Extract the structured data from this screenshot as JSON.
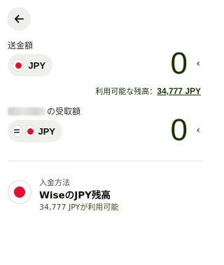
{
  "header": {
    "back_icon": "arrow-left-icon"
  },
  "send": {
    "label": "送金額",
    "currency": "JPY",
    "flag_icon": "japan-flag-icon",
    "amount": "0",
    "chevron": "‹",
    "balance_prefix": "利用可能な残高：",
    "balance_value": "34,777 JPY"
  },
  "receive": {
    "label_suffix": "の受取額",
    "currency": "JPY",
    "equals_icon": "equals-icon",
    "flag_icon": "japan-flag-icon",
    "amount": "0",
    "chevron": "‹"
  },
  "payment_method": {
    "label": "入金方法",
    "name": "WiseのJPY残高",
    "subtext": "34,777 JPYが利用可能",
    "flag_icon": "japan-flag-icon"
  },
  "colors": {
    "amount": "#163300",
    "pill_bg": "#eff0ec",
    "flag_red": "#e0102e",
    "subtext_green": "#2f5711"
  }
}
